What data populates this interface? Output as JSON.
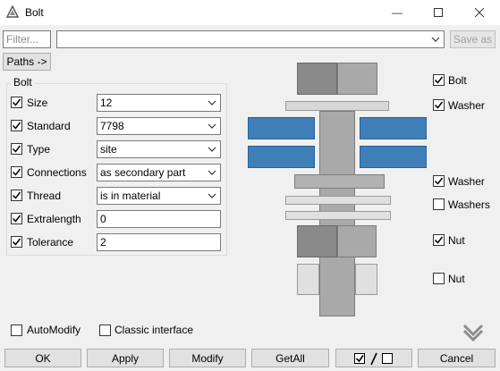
{
  "window": {
    "title": "Bolt",
    "minimize_glyph": "—",
    "maximize_glyph": "☐",
    "close_glyph": "✕"
  },
  "toolbar": {
    "filter_placeholder": "Filter...",
    "preset_value": "",
    "save_as_label": "Save as",
    "paths_label": "Paths ->"
  },
  "bolt_group": {
    "title": "Bolt",
    "rows": [
      {
        "label": "Size",
        "value": "12",
        "kind": "combo",
        "checked": true
      },
      {
        "label": "Standard",
        "value": "7798",
        "kind": "combo",
        "checked": true
      },
      {
        "label": "Type",
        "value": "site",
        "kind": "combo",
        "checked": true
      },
      {
        "label": "Connections",
        "value": "as secondary part",
        "kind": "combo",
        "checked": true
      },
      {
        "label": "Thread",
        "value": "is in material",
        "kind": "combo",
        "checked": true
      },
      {
        "label": "Extralength",
        "value": "0",
        "kind": "text",
        "checked": true
      },
      {
        "label": "Tolerance",
        "value": "2",
        "kind": "text",
        "checked": true
      }
    ]
  },
  "diagram_options": {
    "bolt": {
      "label": "Bolt",
      "checked": true
    },
    "washer_top": {
      "label": "Washer",
      "checked": true
    },
    "washer_mid": {
      "label": "Washer",
      "checked": true
    },
    "washers": {
      "label": "Washers",
      "checked": false
    },
    "nut_1": {
      "label": "Nut",
      "checked": true
    },
    "nut_2": {
      "label": "Nut",
      "checked": false
    }
  },
  "bottom_options": {
    "automodify": {
      "label": "AutoModify",
      "checked": false
    },
    "classic": {
      "label": "Classic interface",
      "checked": false
    }
  },
  "buttons": {
    "ok": "OK",
    "apply": "Apply",
    "modify": "Modify",
    "getall": "GetAll",
    "cancel": "Cancel"
  },
  "colors": {
    "plate_blue": "#3f7fb8",
    "accent_chevron": "#8c8c8c"
  }
}
